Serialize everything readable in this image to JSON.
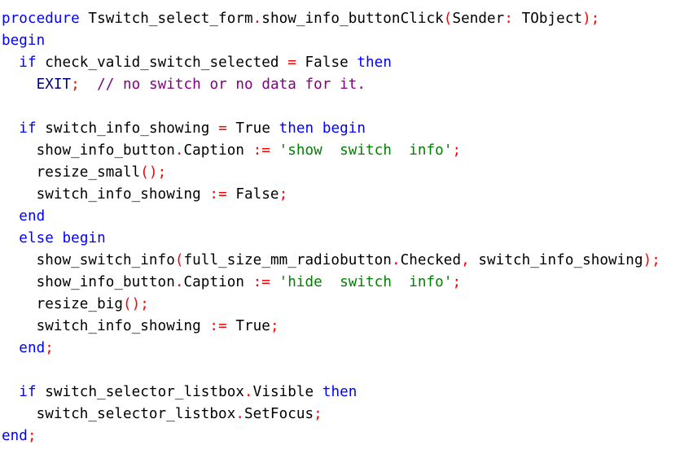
{
  "editor": {
    "language": "Pascal",
    "colors": {
      "keyword": "#0000ff",
      "symbol": "#ff0000",
      "string": "#008000",
      "comment": "#800080",
      "identifier": "#000000",
      "exit": "#000080",
      "background": "#ffffff"
    },
    "lines": [
      [
        [
          "kw",
          "procedure"
        ],
        [
          "id",
          " Tswitch_select_form"
        ],
        [
          "sym",
          "."
        ],
        [
          "id",
          "show_info_buttonClick"
        ],
        [
          "sym",
          "("
        ],
        [
          "id",
          "Sender"
        ],
        [
          "sym",
          ":"
        ],
        [
          "id",
          " TObject"
        ],
        [
          "sym",
          ");"
        ]
      ],
      [
        [
          "kw",
          "begin"
        ]
      ],
      [
        [
          "id",
          "  "
        ],
        [
          "kw",
          "if"
        ],
        [
          "id",
          " check_valid_switch_selected "
        ],
        [
          "sym",
          "="
        ],
        [
          "id",
          " False "
        ],
        [
          "kw",
          "then"
        ]
      ],
      [
        [
          "id",
          "    "
        ],
        [
          "kw2",
          "EXIT"
        ],
        [
          "sym",
          ";"
        ],
        [
          "id",
          "  "
        ],
        [
          "cmt",
          "// no switch or no data for it."
        ]
      ],
      [
        [
          "id",
          ""
        ]
      ],
      [
        [
          "id",
          "  "
        ],
        [
          "kw",
          "if"
        ],
        [
          "id",
          " switch_info_showing "
        ],
        [
          "sym",
          "="
        ],
        [
          "id",
          " True "
        ],
        [
          "kw",
          "then"
        ],
        [
          "id",
          " "
        ],
        [
          "kw",
          "begin"
        ]
      ],
      [
        [
          "id",
          "    show_info_button"
        ],
        [
          "sym",
          "."
        ],
        [
          "id",
          "Caption "
        ],
        [
          "sym",
          ":="
        ],
        [
          "id",
          " "
        ],
        [
          "str",
          "'show  switch  info'"
        ],
        [
          "sym",
          ";"
        ]
      ],
      [
        [
          "id",
          "    resize_small"
        ],
        [
          "sym",
          "();"
        ]
      ],
      [
        [
          "id",
          "    switch_info_showing "
        ],
        [
          "sym",
          ":="
        ],
        [
          "id",
          " False"
        ],
        [
          "sym",
          ";"
        ]
      ],
      [
        [
          "id",
          "  "
        ],
        [
          "kw",
          "end"
        ]
      ],
      [
        [
          "id",
          "  "
        ],
        [
          "kw",
          "else"
        ],
        [
          "id",
          " "
        ],
        [
          "kw",
          "begin"
        ]
      ],
      [
        [
          "id",
          "    show_switch_info"
        ],
        [
          "sym",
          "("
        ],
        [
          "id",
          "full_size_mm_radiobutton"
        ],
        [
          "sym",
          "."
        ],
        [
          "id",
          "Checked"
        ],
        [
          "sym",
          ","
        ],
        [
          "id",
          " switch_info_showing"
        ],
        [
          "sym",
          ");"
        ]
      ],
      [
        [
          "id",
          "    show_info_button"
        ],
        [
          "sym",
          "."
        ],
        [
          "id",
          "Caption "
        ],
        [
          "sym",
          ":="
        ],
        [
          "id",
          " "
        ],
        [
          "str",
          "'hide  switch  info'"
        ],
        [
          "sym",
          ";"
        ]
      ],
      [
        [
          "id",
          "    resize_big"
        ],
        [
          "sym",
          "();"
        ]
      ],
      [
        [
          "id",
          "    switch_info_showing "
        ],
        [
          "sym",
          ":="
        ],
        [
          "id",
          " True"
        ],
        [
          "sym",
          ";"
        ]
      ],
      [
        [
          "id",
          "  "
        ],
        [
          "kw",
          "end"
        ],
        [
          "sym",
          ";"
        ]
      ],
      [
        [
          "id",
          ""
        ]
      ],
      [
        [
          "id",
          "  "
        ],
        [
          "kw",
          "if"
        ],
        [
          "id",
          " switch_selector_listbox"
        ],
        [
          "sym",
          "."
        ],
        [
          "id",
          "Visible "
        ],
        [
          "kw",
          "then"
        ]
      ],
      [
        [
          "id",
          "    switch_selector_listbox"
        ],
        [
          "sym",
          "."
        ],
        [
          "id",
          "SetFocus"
        ],
        [
          "sym",
          ";"
        ]
      ],
      [
        [
          "kw",
          "end"
        ],
        [
          "sym",
          ";"
        ]
      ]
    ]
  }
}
